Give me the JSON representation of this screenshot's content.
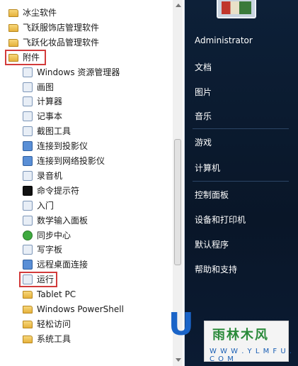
{
  "programs": [
    {
      "label": "冰尘软件",
      "icon": "folder-icon",
      "kind": "folder",
      "indent": 0
    },
    {
      "label": "飞跃服饰店管理软件",
      "icon": "folder-icon",
      "kind": "folder",
      "indent": 0
    },
    {
      "label": "飞跃化妆品管理软件",
      "icon": "folder-icon",
      "kind": "folder",
      "indent": 0
    },
    {
      "label": "附件",
      "icon": "folder-icon",
      "kind": "folder",
      "indent": 0,
      "highlight": true
    },
    {
      "label": "Windows 资源管理器",
      "icon": "explorer-icon",
      "kind": "app",
      "indent": 1
    },
    {
      "label": "画图",
      "icon": "paint-icon",
      "kind": "app",
      "indent": 1
    },
    {
      "label": "计算器",
      "icon": "calculator-icon",
      "kind": "app",
      "indent": 1
    },
    {
      "label": "记事本",
      "icon": "notepad-icon",
      "kind": "app",
      "indent": 1
    },
    {
      "label": "截图工具",
      "icon": "snipping-tool-icon",
      "kind": "app",
      "indent": 1
    },
    {
      "label": "连接到投影仪",
      "icon": "projector-icon",
      "kind": "app",
      "indent": 1
    },
    {
      "label": "连接到网络投影仪",
      "icon": "network-projector-icon",
      "kind": "app",
      "indent": 1
    },
    {
      "label": "录音机",
      "icon": "microphone-icon",
      "kind": "app",
      "indent": 1
    },
    {
      "label": "命令提示符",
      "icon": "command-prompt-icon",
      "kind": "app",
      "indent": 1
    },
    {
      "label": "入门",
      "icon": "getting-started-icon",
      "kind": "app",
      "indent": 1
    },
    {
      "label": "数学输入面板",
      "icon": "math-input-icon",
      "kind": "app",
      "indent": 1
    },
    {
      "label": "同步中心",
      "icon": "sync-center-icon",
      "kind": "app",
      "indent": 1
    },
    {
      "label": "写字板",
      "icon": "wordpad-icon",
      "kind": "app",
      "indent": 1
    },
    {
      "label": "远程桌面连接",
      "icon": "remote-desktop-icon",
      "kind": "app",
      "indent": 1
    },
    {
      "label": "运行",
      "icon": "run-icon",
      "kind": "app",
      "indent": 1,
      "highlight": true
    },
    {
      "label": "Tablet PC",
      "icon": "folder-icon",
      "kind": "folder",
      "indent": 1
    },
    {
      "label": "Windows PowerShell",
      "icon": "folder-icon",
      "kind": "folder",
      "indent": 1
    },
    {
      "label": "轻松访问",
      "icon": "folder-icon",
      "kind": "folder",
      "indent": 1
    },
    {
      "label": "系统工具",
      "icon": "folder-icon",
      "kind": "folder",
      "indent": 1
    }
  ],
  "right_menu": {
    "user": "Administrator",
    "items": [
      "文档",
      "图片",
      "音乐",
      "游戏",
      "计算机",
      "控制面板",
      "设备和打印机",
      "默认程序",
      "帮助和支持"
    ]
  },
  "watermark": {
    "letter": "U",
    "site_name": "雨林木风",
    "site_url": "W W W . Y L M F U . C O M"
  },
  "colors": {
    "highlight": "#d23b3b",
    "panel": "#0c1a33"
  }
}
